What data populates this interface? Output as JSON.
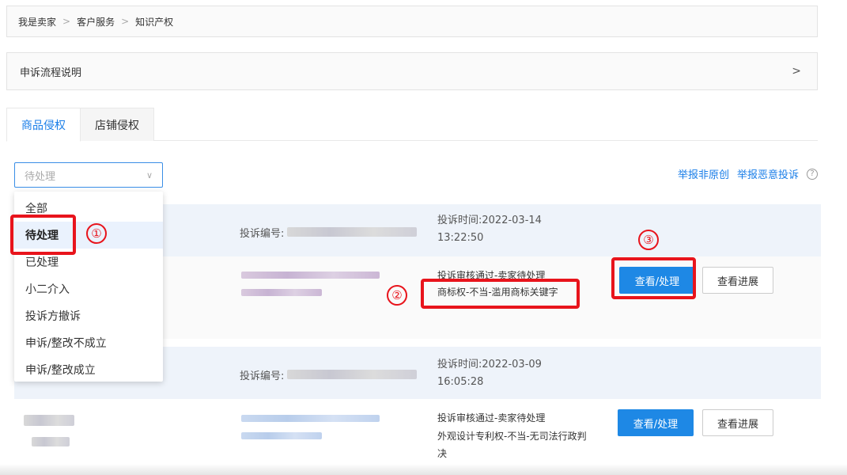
{
  "breadcrumb": [
    "我是卖家",
    "客户服务",
    "知识产权"
  ],
  "breadcrumb_sep": ">",
  "appeal": {
    "label": "申诉流程说明",
    "chevron": ">"
  },
  "tabs": [
    {
      "label": "商品侵权",
      "active": true
    },
    {
      "label": "店铺侵权",
      "active": false
    }
  ],
  "filter": {
    "value": "待处理",
    "arrow": "∨"
  },
  "report_links": {
    "non_original": "举报非原创",
    "malicious": "举报恶意投诉",
    "help_icon": "?"
  },
  "dropdown": {
    "options": [
      "全部",
      "待处理",
      "已处理",
      "小二介入",
      "投诉方撤诉",
      "申诉/整改不成立",
      "申诉/整改成立"
    ],
    "selected_index": 1
  },
  "complaints": [
    {
      "id_label": "投诉编号:",
      "time_label": "投诉时间:2022-03-14",
      "time_clock": "13:22:50",
      "status_line1": "投诉审核通过-卖家待处理",
      "status_line2": "商标权-不当-滥用商标关键字",
      "status_line3": "",
      "primary_btn": "查看/处理",
      "secondary_btn": "查看进展"
    },
    {
      "id_label": "投诉编号:",
      "time_label": "投诉时间:2022-03-09",
      "time_clock": "16:05:28",
      "status_line1": "投诉审核通过-卖家待处理",
      "status_line2": "外观设计专利权-不当-无司法行政判",
      "status_line3": "决",
      "primary_btn": "查看/处理",
      "secondary_btn": "查看进展"
    }
  ],
  "markers": [
    "①",
    "②",
    "③"
  ],
  "colors": {
    "accent": "#1e88e5",
    "highlight": "#e8141c"
  }
}
